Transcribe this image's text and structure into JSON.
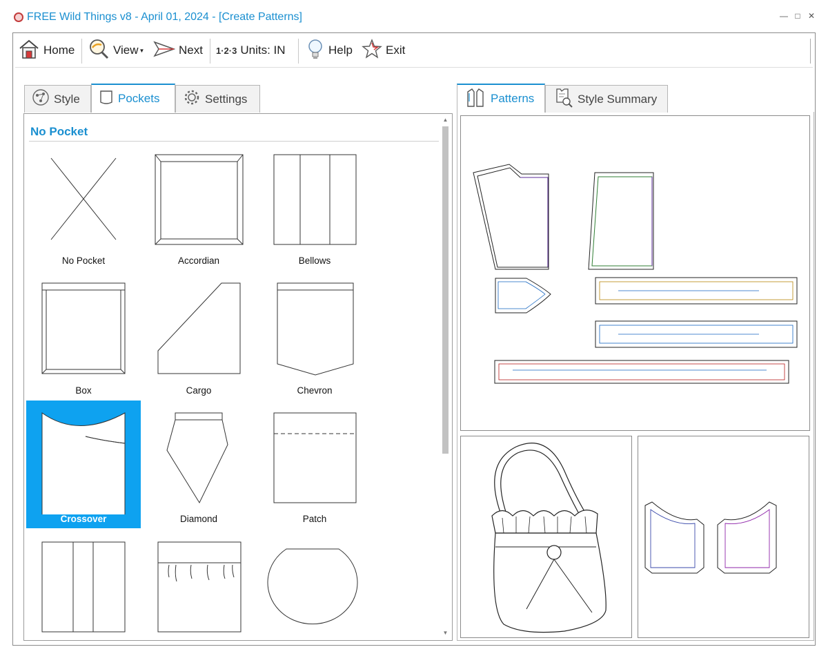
{
  "window": {
    "title": "FREE Wild Things v8 - April 01, 2024 - [Create Patterns]",
    "minimize_glyph": "—",
    "maximize_glyph": "□",
    "close_glyph": "✕"
  },
  "toolbar": {
    "home_label": "Home",
    "view_label": "View",
    "next_label": "Next",
    "units_prefix": "1·2·3",
    "units_label": "Units: IN",
    "help_label": "Help",
    "exit_label": "Exit"
  },
  "left_tabs": [
    {
      "label": "Style",
      "icon": "style-icon",
      "active": false
    },
    {
      "label": "Pockets",
      "icon": "pocket-icon",
      "active": true
    },
    {
      "label": "Settings",
      "icon": "gear-icon",
      "active": false
    }
  ],
  "section": {
    "title": "No Pocket"
  },
  "pockets": [
    {
      "label": "No Pocket",
      "selected": false
    },
    {
      "label": "Accordian",
      "selected": false
    },
    {
      "label": "Bellows",
      "selected": false
    },
    {
      "label": "Box",
      "selected": false
    },
    {
      "label": "Cargo",
      "selected": false
    },
    {
      "label": "Chevron",
      "selected": false
    },
    {
      "label": "Crossover",
      "selected": true
    },
    {
      "label": "Diamond",
      "selected": false
    },
    {
      "label": "Patch",
      "selected": false
    },
    {
      "label": "",
      "selected": false
    },
    {
      "label": "",
      "selected": false
    },
    {
      "label": "",
      "selected": false
    }
  ],
  "right_tabs": [
    {
      "label": "Patterns",
      "icon": "patterns-icon",
      "active": true
    },
    {
      "label": "Style Summary",
      "icon": "style-summary-icon",
      "active": false
    }
  ],
  "colors": {
    "accent": "#1a8fd0",
    "selection": "#0ea2f0"
  }
}
